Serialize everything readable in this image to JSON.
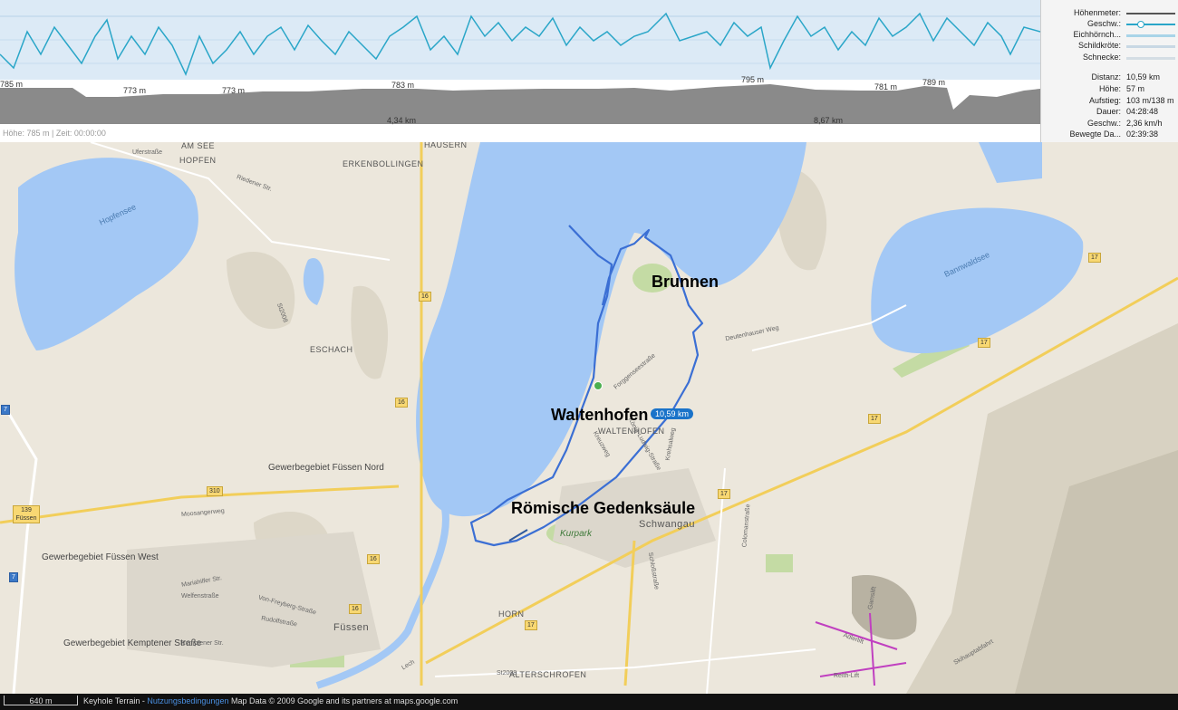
{
  "profile": {
    "elevation_labels": [
      "785 m",
      "773 m",
      "773 m",
      "783 m",
      "795 m",
      "781 m",
      "789 m"
    ],
    "distance_labels": [
      "4,34 km",
      "8,67 km"
    ],
    "status": "Höhe: 785 m | Zeit: 00:00:00"
  },
  "legend": [
    {
      "label": "Höhenmeter:",
      "color": "#555555"
    },
    {
      "label": "Geschw.:",
      "color": "#2aa6c8"
    },
    {
      "label": "Eichhörnch...",
      "color": "#a8d4e8"
    },
    {
      "label": "Schildkröte:",
      "color": "#c8d8e4"
    },
    {
      "label": "Schnecke:",
      "color": "#d4dde4"
    }
  ],
  "stats": [
    {
      "label": "Distanz:",
      "value": "10,59 km"
    },
    {
      "label": "Höhe:",
      "value": "57 m"
    },
    {
      "label": "Aufstieg:",
      "value": "103 m/138 m"
    },
    {
      "label": "Dauer:",
      "value": "04:28:48"
    },
    {
      "label": "Geschw.:",
      "value": "2,36 km/h"
    },
    {
      "label": "Bewegte Da...",
      "value": "02:39:38"
    }
  ],
  "map": {
    "places": [
      "AM SEE",
      "HOPFEN",
      "ERKENBOLLINGEN",
      "HAUSERN",
      "ESCHACH",
      "WALTENHOFEN",
      "Schwangau",
      "HORN",
      "ALTERSCHROFEN",
      "Füssen"
    ],
    "pois": [
      "Gewerbegebiet Füssen Nord",
      "Gewerbegebiet Füssen West",
      "Gewerbegebiet Kemptener Straße",
      "Kurpark"
    ],
    "lakes": [
      "Hopfensee",
      "Bannwaldsee"
    ],
    "streets": [
      "Uferstraße",
      "Riedener Str.",
      "St2008",
      "Forggenseestraße",
      "Deutenhauser Weg",
      "Moosangerweg",
      "Mariahilfer Str.",
      "Welfenstraße",
      "Kemptener Str.",
      "Rudolfstraße",
      "Von-Freyberg-Straße",
      "König-Ludwig-Straße",
      "Kreuzweg",
      "Krehsalweg",
      "Colomanstraße",
      "Schloßstraße",
      "Adlerlift",
      "Gamslift",
      "Reith-Lift",
      "Skihauptabfahrt",
      "Lech",
      "St2008"
    ],
    "route_labels": [
      "16",
      "16",
      "16",
      "16",
      "17",
      "17",
      "17",
      "17",
      "17",
      "310",
      "139 Füssen",
      "7",
      "7"
    ],
    "waypoints": [
      "Brunnen",
      "Waltenhofen",
      "Römische Gedenksäule"
    ],
    "distance_badge": "10,59 km"
  },
  "footer": {
    "scale": "640 m",
    "attribution_prefix": "Keyhole Terrain - ",
    "attribution_link": "Nutzungsbedingungen",
    "attribution_suffix": " Map Data © 2009 Google and its partners at maps.google.com"
  },
  "colors": {
    "water": "#a3c8f5",
    "route": "#3b6fd4",
    "speed_line": "#2aa6c8",
    "elevation_fill": "#8a8a8a",
    "road_yellow": "#f8d873"
  }
}
